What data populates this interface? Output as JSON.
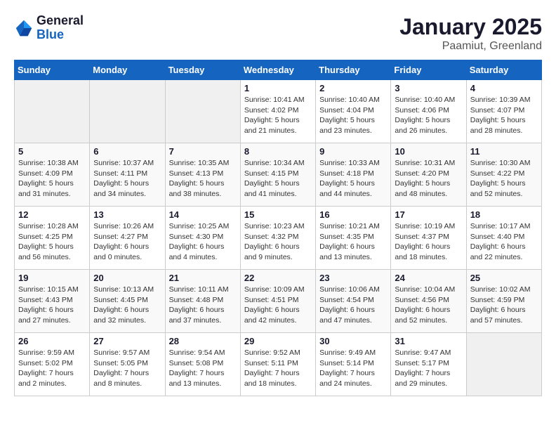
{
  "header": {
    "logo_general": "General",
    "logo_blue": "Blue",
    "title": "January 2025",
    "subtitle": "Paamiut, Greenland"
  },
  "weekdays": [
    "Sunday",
    "Monday",
    "Tuesday",
    "Wednesday",
    "Thursday",
    "Friday",
    "Saturday"
  ],
  "weeks": [
    [
      {
        "day": "",
        "info": ""
      },
      {
        "day": "",
        "info": ""
      },
      {
        "day": "",
        "info": ""
      },
      {
        "day": "1",
        "info": "Sunrise: 10:41 AM\nSunset: 4:02 PM\nDaylight: 5 hours\nand 21 minutes."
      },
      {
        "day": "2",
        "info": "Sunrise: 10:40 AM\nSunset: 4:04 PM\nDaylight: 5 hours\nand 23 minutes."
      },
      {
        "day": "3",
        "info": "Sunrise: 10:40 AM\nSunset: 4:06 PM\nDaylight: 5 hours\nand 26 minutes."
      },
      {
        "day": "4",
        "info": "Sunrise: 10:39 AM\nSunset: 4:07 PM\nDaylight: 5 hours\nand 28 minutes."
      }
    ],
    [
      {
        "day": "5",
        "info": "Sunrise: 10:38 AM\nSunset: 4:09 PM\nDaylight: 5 hours\nand 31 minutes."
      },
      {
        "day": "6",
        "info": "Sunrise: 10:37 AM\nSunset: 4:11 PM\nDaylight: 5 hours\nand 34 minutes."
      },
      {
        "day": "7",
        "info": "Sunrise: 10:35 AM\nSunset: 4:13 PM\nDaylight: 5 hours\nand 38 minutes."
      },
      {
        "day": "8",
        "info": "Sunrise: 10:34 AM\nSunset: 4:15 PM\nDaylight: 5 hours\nand 41 minutes."
      },
      {
        "day": "9",
        "info": "Sunrise: 10:33 AM\nSunset: 4:18 PM\nDaylight: 5 hours\nand 44 minutes."
      },
      {
        "day": "10",
        "info": "Sunrise: 10:31 AM\nSunset: 4:20 PM\nDaylight: 5 hours\nand 48 minutes."
      },
      {
        "day": "11",
        "info": "Sunrise: 10:30 AM\nSunset: 4:22 PM\nDaylight: 5 hours\nand 52 minutes."
      }
    ],
    [
      {
        "day": "12",
        "info": "Sunrise: 10:28 AM\nSunset: 4:25 PM\nDaylight: 5 hours\nand 56 minutes."
      },
      {
        "day": "13",
        "info": "Sunrise: 10:26 AM\nSunset: 4:27 PM\nDaylight: 6 hours\nand 0 minutes."
      },
      {
        "day": "14",
        "info": "Sunrise: 10:25 AM\nSunset: 4:30 PM\nDaylight: 6 hours\nand 4 minutes."
      },
      {
        "day": "15",
        "info": "Sunrise: 10:23 AM\nSunset: 4:32 PM\nDaylight: 6 hours\nand 9 minutes."
      },
      {
        "day": "16",
        "info": "Sunrise: 10:21 AM\nSunset: 4:35 PM\nDaylight: 6 hours\nand 13 minutes."
      },
      {
        "day": "17",
        "info": "Sunrise: 10:19 AM\nSunset: 4:37 PM\nDaylight: 6 hours\nand 18 minutes."
      },
      {
        "day": "18",
        "info": "Sunrise: 10:17 AM\nSunset: 4:40 PM\nDaylight: 6 hours\nand 22 minutes."
      }
    ],
    [
      {
        "day": "19",
        "info": "Sunrise: 10:15 AM\nSunset: 4:43 PM\nDaylight: 6 hours\nand 27 minutes."
      },
      {
        "day": "20",
        "info": "Sunrise: 10:13 AM\nSunset: 4:45 PM\nDaylight: 6 hours\nand 32 minutes."
      },
      {
        "day": "21",
        "info": "Sunrise: 10:11 AM\nSunset: 4:48 PM\nDaylight: 6 hours\nand 37 minutes."
      },
      {
        "day": "22",
        "info": "Sunrise: 10:09 AM\nSunset: 4:51 PM\nDaylight: 6 hours\nand 42 minutes."
      },
      {
        "day": "23",
        "info": "Sunrise: 10:06 AM\nSunset: 4:54 PM\nDaylight: 6 hours\nand 47 minutes."
      },
      {
        "day": "24",
        "info": "Sunrise: 10:04 AM\nSunset: 4:56 PM\nDaylight: 6 hours\nand 52 minutes."
      },
      {
        "day": "25",
        "info": "Sunrise: 10:02 AM\nSunset: 4:59 PM\nDaylight: 6 hours\nand 57 minutes."
      }
    ],
    [
      {
        "day": "26",
        "info": "Sunrise: 9:59 AM\nSunset: 5:02 PM\nDaylight: 7 hours\nand 2 minutes."
      },
      {
        "day": "27",
        "info": "Sunrise: 9:57 AM\nSunset: 5:05 PM\nDaylight: 7 hours\nand 8 minutes."
      },
      {
        "day": "28",
        "info": "Sunrise: 9:54 AM\nSunset: 5:08 PM\nDaylight: 7 hours\nand 13 minutes."
      },
      {
        "day": "29",
        "info": "Sunrise: 9:52 AM\nSunset: 5:11 PM\nDaylight: 7 hours\nand 18 minutes."
      },
      {
        "day": "30",
        "info": "Sunrise: 9:49 AM\nSunset: 5:14 PM\nDaylight: 7 hours\nand 24 minutes."
      },
      {
        "day": "31",
        "info": "Sunrise: 9:47 AM\nSunset: 5:17 PM\nDaylight: 7 hours\nand 29 minutes."
      },
      {
        "day": "",
        "info": ""
      }
    ]
  ]
}
